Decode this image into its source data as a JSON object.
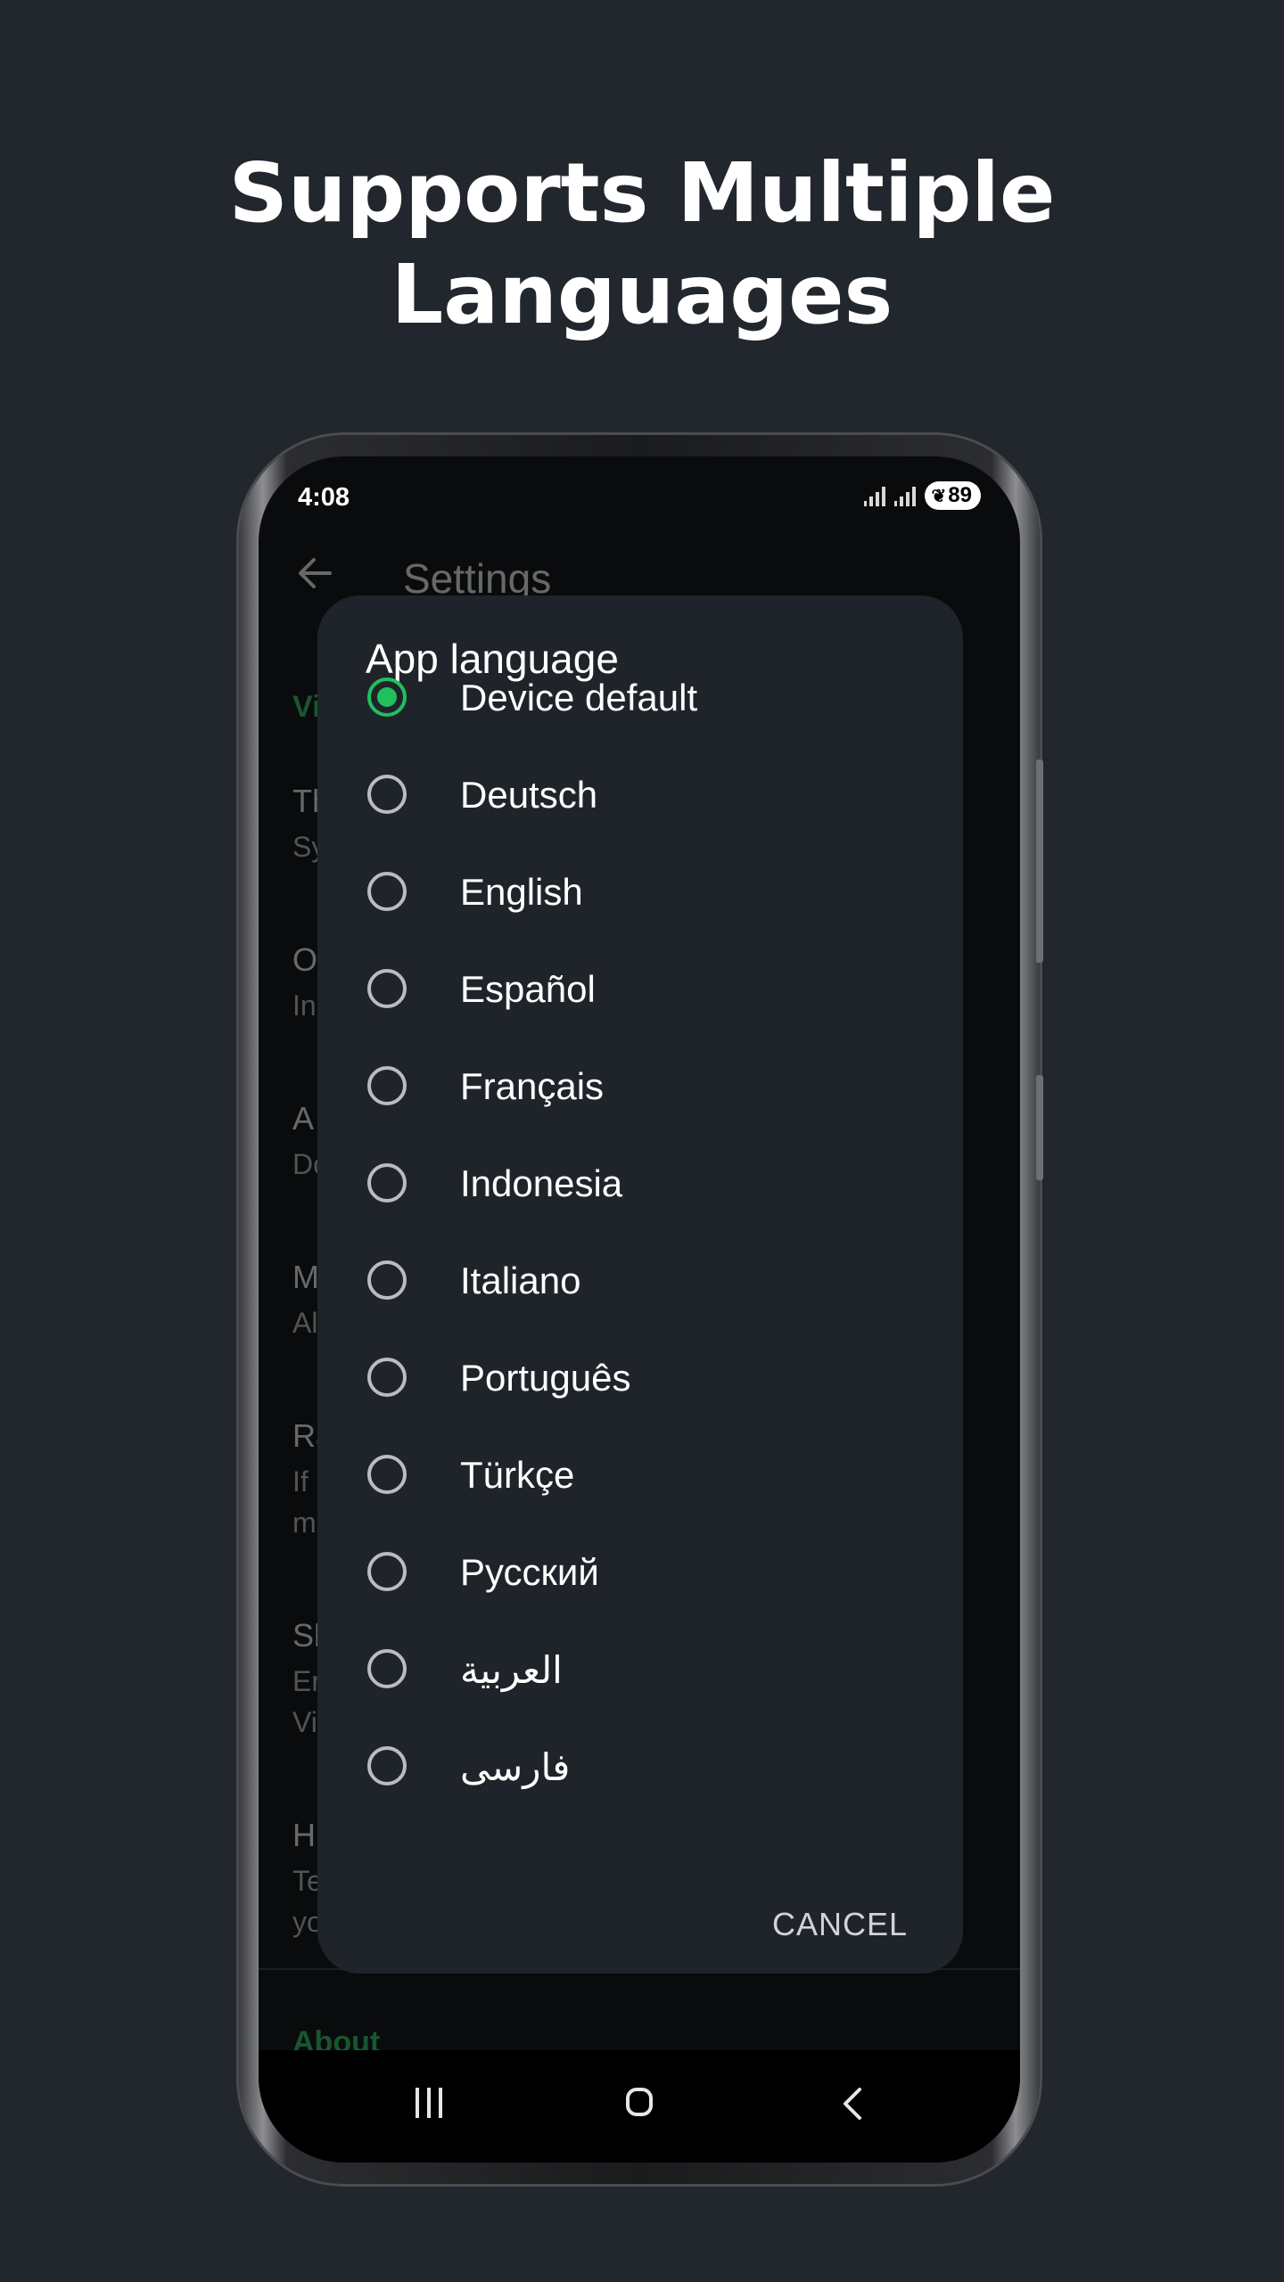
{
  "headline": {
    "line1": "Supports Multiple",
    "line2": "Languages"
  },
  "status_bar": {
    "time": "4:08",
    "battery": "89"
  },
  "settings_bg": {
    "title": "Settings",
    "section_top": "Vi",
    "section_bottom": "About",
    "items": [
      {
        "title": "Th",
        "subtitle": "Sy"
      },
      {
        "title": "O",
        "subtitle": "In"
      },
      {
        "title": "A",
        "subtitle": "Do"
      },
      {
        "title": "M",
        "subtitle": "Al"
      },
      {
        "title": "Ra",
        "subtitle": "If",
        "subtitle2": "m"
      },
      {
        "title": "Sh",
        "subtitle": "Er",
        "subtitle2": "Vi"
      },
      {
        "title": "H",
        "subtitle": "Te",
        "subtitle2": "yo"
      }
    ]
  },
  "dialog": {
    "title": "App language",
    "selected_index": 0,
    "options": [
      "Device default",
      "Deutsch",
      "English",
      "Español",
      "Français",
      "Indonesia",
      "Italiano",
      "Português",
      "Türkçe",
      "Русский",
      "العربية",
      "فارسی"
    ],
    "cancel_label": "CANCEL"
  },
  "colors": {
    "accent": "#20c05e",
    "background": "#22262d",
    "dialog": "#1f242a"
  }
}
